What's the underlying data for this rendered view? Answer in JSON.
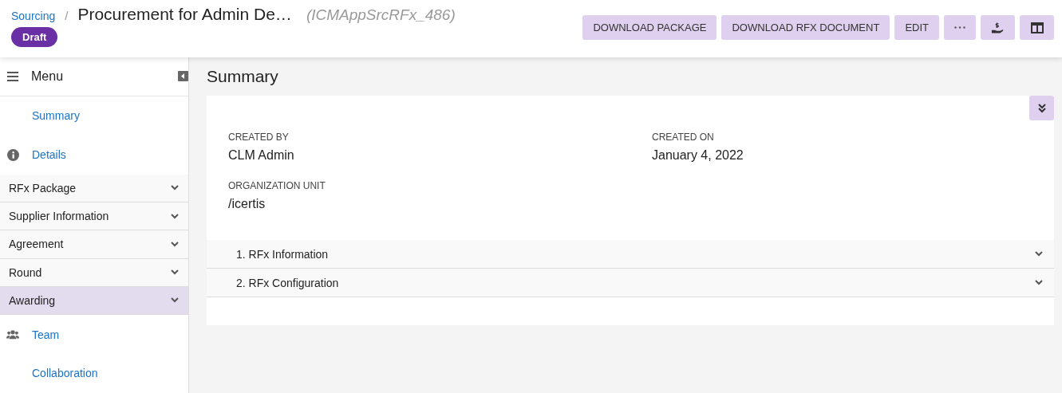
{
  "breadcrumb": {
    "parent": "Sourcing",
    "separator": "/",
    "title": "Procurement for Admin De…",
    "id": "(ICMAppSrcRFx_486)"
  },
  "status": "Draft",
  "actions": [
    {
      "label": "DOWNLOAD PACKAGE"
    },
    {
      "label": "DOWNLOAD RFX DOCUMENT"
    },
    {
      "label": "EDIT"
    }
  ],
  "menu": {
    "title": "Menu",
    "items": [
      {
        "label": "Summary",
        "kind": "link",
        "selected": false
      },
      {
        "label": "Details",
        "kind": "info",
        "selected": false
      },
      {
        "label": "RFx Package",
        "kind": "group",
        "selected": false
      },
      {
        "label": "Supplier Information",
        "kind": "group",
        "selected": false
      },
      {
        "label": "Agreement",
        "kind": "group",
        "selected": false
      },
      {
        "label": "Round",
        "kind": "group",
        "selected": false
      },
      {
        "label": "Awarding",
        "kind": "group",
        "selected": true
      },
      {
        "label": "Team",
        "kind": "team",
        "selected": false
      },
      {
        "label": "Collaboration",
        "kind": "link",
        "selected": false
      }
    ]
  },
  "page_title": "Summary",
  "fields": [
    {
      "label": "CREATED BY",
      "value": "CLM Admin"
    },
    {
      "label": "CREATED ON",
      "value": "January 4, 2022"
    },
    {
      "label": "ORGANIZATION UNIT",
      "value": "/icertis"
    }
  ],
  "sections": [
    {
      "label": "1. RFx Information",
      "expanded": false
    },
    {
      "label": "2. RFx Configuration",
      "expanded": false
    }
  ]
}
